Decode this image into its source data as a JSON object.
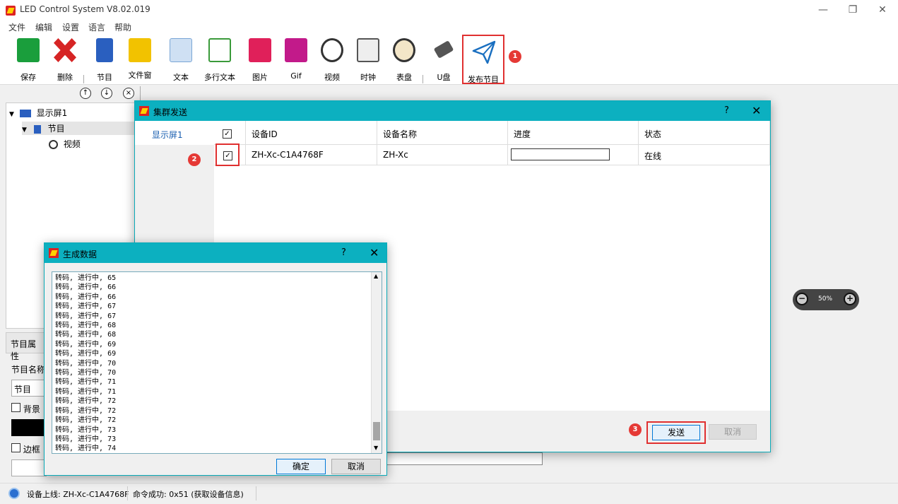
{
  "window": {
    "title": "LED Control System V8.02.019",
    "minimize": "—",
    "restore": "❐",
    "close": "✕"
  },
  "menu": [
    "文件",
    "编辑",
    "设置",
    "语言",
    "帮助"
  ],
  "toolbar": [
    {
      "name": "save",
      "label": "保存",
      "color": "#1a9e3c"
    },
    {
      "name": "delete",
      "label": "删除",
      "color": "#d62424"
    },
    {
      "name": "program",
      "label": "节目",
      "color": "#2a5fbf"
    },
    {
      "name": "window",
      "label": "文件窗",
      "color": "#f2c200"
    },
    {
      "name": "text",
      "label": "文本",
      "color": "#7aa6d6"
    },
    {
      "name": "multitext",
      "label": "多行文本",
      "color": "#3a9a3a"
    },
    {
      "name": "picture",
      "label": "图片",
      "color": "#e0205a"
    },
    {
      "name": "gif",
      "label": "Gif",
      "color": "#c21a8a"
    },
    {
      "name": "video",
      "label": "视频",
      "color": "#333333"
    },
    {
      "name": "clock",
      "label": "时钟",
      "color": "#555555"
    },
    {
      "name": "dial",
      "label": "表盘",
      "color": "#8a5a2a"
    },
    {
      "name": "udisk",
      "label": "U盘",
      "color": "#444444"
    },
    {
      "name": "publish",
      "label": "发布节目",
      "color": "#1a6fc0"
    }
  ],
  "tree": {
    "screen": "显示屏1",
    "program": "节目",
    "video": "视频",
    "up": "↑",
    "down": "↓",
    "remove": "×"
  },
  "zoom": {
    "level": "50%",
    "minus": "−",
    "plus": "+"
  },
  "props": {
    "tab": "节目属性",
    "name_label": "节目名称",
    "name_value": "节目",
    "background": "背景",
    "border": "边框"
  },
  "status": {
    "online": "设备上线: ZH-Xc-C1A4768F",
    "command": "命令成功: 0x51 (获取设备信息)"
  },
  "cluster_dialog": {
    "title": "集群发送",
    "help": "?",
    "close": "✕",
    "sidebar_item": "显示屏1",
    "columns": [
      "设备ID",
      "设备名称",
      "进度",
      "状态"
    ],
    "rows": [
      {
        "id": "ZH-Xc-C1A4768F",
        "name": "ZH-Xc",
        "progress": 0,
        "status": "在线"
      }
    ],
    "send": "发送",
    "cancel": "取消"
  },
  "gen_dialog": {
    "title": "生成数据",
    "help": "?",
    "close": "✕",
    "log": [
      "转码, 进行中, 65",
      "转码, 进行中, 66",
      "转码, 进行中, 66",
      "转码, 进行中, 67",
      "转码, 进行中, 67",
      "转码, 进行中, 68",
      "转码, 进行中, 68",
      "转码, 进行中, 69",
      "转码, 进行中, 69",
      "转码, 进行中, 70",
      "转码, 进行中, 70",
      "转码, 进行中, 71",
      "转码, 进行中, 71",
      "转码, 进行中, 72",
      "转码, 进行中, 72",
      "转码, 进行中, 72",
      "转码, 进行中, 73",
      "转码, 进行中, 73",
      "转码, 进行中, 74"
    ],
    "ok": "确定",
    "cancel": "取消"
  },
  "badges": [
    "1",
    "2",
    "3"
  ]
}
